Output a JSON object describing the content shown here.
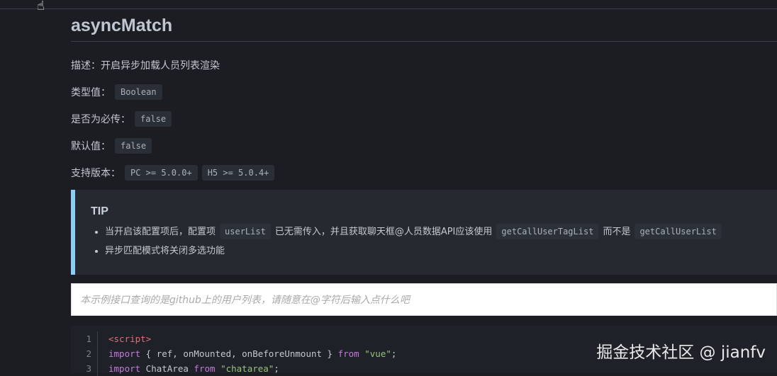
{
  "title": "asyncMatch",
  "props": [
    {
      "label": "描述：",
      "text": "开启异步加载人员列表渲染"
    },
    {
      "label": "类型值：",
      "codes": [
        "Boolean"
      ]
    },
    {
      "label": "是否为必传：",
      "codes": [
        "false"
      ]
    },
    {
      "label": "默认值：",
      "codes": [
        "false"
      ]
    },
    {
      "label": "支持版本：",
      "codes": [
        "PC >= 5.0.0+",
        "H5 >= 5.0.4+"
      ]
    }
  ],
  "tip": {
    "title": "TIP",
    "item1": {
      "a": "当开启该配置项后，配置项",
      "c1": "userList",
      "b": "已无需传入，并且获取聊天框@人员数据API应该使用",
      "c2": "getCallUserTagList",
      "d": "而不是",
      "c3": "getCallUserList"
    },
    "item2": "异步匹配模式将关闭多选功能"
  },
  "input": {
    "placeholder": "本示例接口查询的是github上的用户列表，请随意在@字符后输入点什么吧"
  },
  "code": {
    "l1": {
      "n": "1",
      "t": "<script>"
    },
    "l2": {
      "n": "2",
      "a": "import",
      "b": " { ref, onMounted, onBeforeUnmount } ",
      "c": "from",
      "d": "\"vue\"",
      "e": ";"
    },
    "l3": {
      "n": "3",
      "a": "import",
      "b": " ChatArea ",
      "c": "from",
      "d": "\"chatarea\"",
      "e": ";"
    }
  },
  "watermark": "掘金技术社区 @ jianfv"
}
